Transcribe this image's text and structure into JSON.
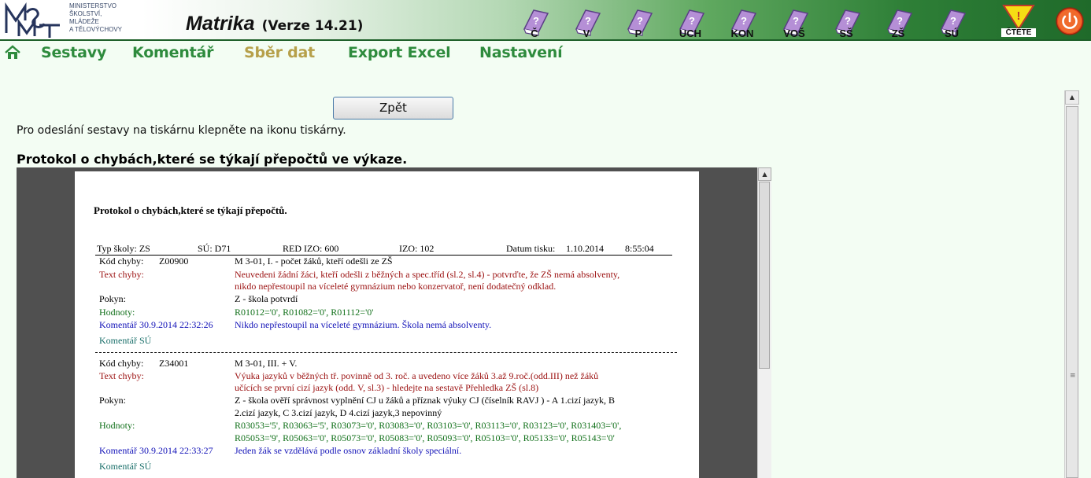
{
  "header": {
    "ministry_lines": [
      "MINISTERSTVO",
      "ŠKOLSTVÍ,",
      "MLÁDEŽE",
      "A TĚLOVÝCHOVY"
    ],
    "app_name": "Matrika",
    "version": "(Verze 14.21)",
    "toolbar": [
      {
        "label": "Č",
        "icon": "help-icon-c"
      },
      {
        "label": "V",
        "icon": "help-icon-v"
      },
      {
        "label": "P",
        "icon": "help-icon-p"
      },
      {
        "label": "UCH",
        "icon": "help-icon-uch"
      },
      {
        "label": "KON",
        "icon": "help-icon-kon"
      },
      {
        "label": "VOŠ",
        "icon": "help-icon-vos"
      },
      {
        "label": "SŠ",
        "icon": "help-icon-ss"
      },
      {
        "label": "ZŠ",
        "icon": "help-icon-zs"
      },
      {
        "label": "SÚ",
        "icon": "help-icon-su"
      }
    ],
    "read_label": "ČTĚTE",
    "colors": {
      "help_icon": "#b58fd6",
      "warn": "#f6dd14",
      "power": "#e8431a"
    }
  },
  "nav": {
    "items": [
      {
        "label": "Sestavy"
      },
      {
        "label": "Komentář"
      },
      {
        "label": "Sběr dat"
      },
      {
        "label": "Export Excel"
      },
      {
        "label": "Nastavení"
      }
    ],
    "active": "Sběr dat"
  },
  "content": {
    "back_label": "Zpět",
    "instruction": "Pro odeslání sestavy na tiskárnu klepněte na ikonu tiskárny.",
    "heading": "Protokol o chybách,které se týkají přepočtů ve výkaze."
  },
  "report": {
    "title": "Protokol o chybách,které se týkají přepočtů.",
    "header": {
      "school_type": "Typ školy: ZS",
      "su": "SÚ: D71",
      "red_izo": "RED  IZO: 600",
      "izo": "IZO: 102",
      "print_date_label": "Datum tisku:",
      "print_date": "1.10.2014",
      "print_time": "8:55:04"
    },
    "entries": [
      {
        "code_label": "Kód chyby:",
        "code": "Z00900",
        "title": "M 3-01, I. - počet žáků, kteří odešli ze ZŠ",
        "text_label": "Text chyby:",
        "text_lines": [
          "Neuvedeni žádní žáci, kteří odešli z běžných a spec.tříd (sl.2, sl.4) - potvrďte, že ZŠ nemá absolventy,",
          "nikdo nepřestoupil na víceleté gymnázium nebo konzervatoř, není dodatečný odklad."
        ],
        "instr_label": "Pokyn:",
        "instr_lines": [
          "Z - škola potvrdí"
        ],
        "values_label": "Hodnoty:",
        "values_lines": [
          "R01012='0', R01082='0', R01112='0'"
        ],
        "comment_label": "Komentář  30.9.2014  22:32:26",
        "comment": "Nikdo nepřestoupil na víceleté gymnázium. Škola nemá absolventy.",
        "su_comment_label": "Komentář SÚ"
      },
      {
        "code_label": "Kód chyby:",
        "code": "Z34001",
        "title": "M 3-01, III. + V.",
        "text_label": "Text chyby:",
        "text_lines": [
          "Výuka jazyků v běžných tř. povinně od 3. roč. a uvedeno více žáků 3.až 9.roč.(odd.III) než žáků",
          "učících se první cizí jazyk (odd. V, sl.3) - hledejte na sestavě Přehledka ZŠ (sl.8)"
        ],
        "instr_label": "Pokyn:",
        "instr_lines": [
          "Z - škola ověří správnost vyplnění CJ u žáků a příznak výuky CJ (číselník RAVJ ) - A 1.cizí jazyk, B",
          "2.cizí jazyk, C 3.cizí jazyk, D 4.cizí jazyk,3 nepovinný"
        ],
        "values_label": "Hodnoty:",
        "values_lines": [
          "R03053='5', R03063='5', R03073='0', R03083='0', R03103='0', R03113='0', R03123='0', R031403='0',",
          "R05053='9', R05063='0', R05073='0', R05083='0', R05093='0', R05103='0', R05133='0', R05143='0'"
        ],
        "comment_label": "Komentář  30.9.2014  22:33:27",
        "comment": "Jeden žák se vzdělává podle osnov základní školy speciální.",
        "su_comment_label": "Komentář SÚ"
      }
    ]
  }
}
